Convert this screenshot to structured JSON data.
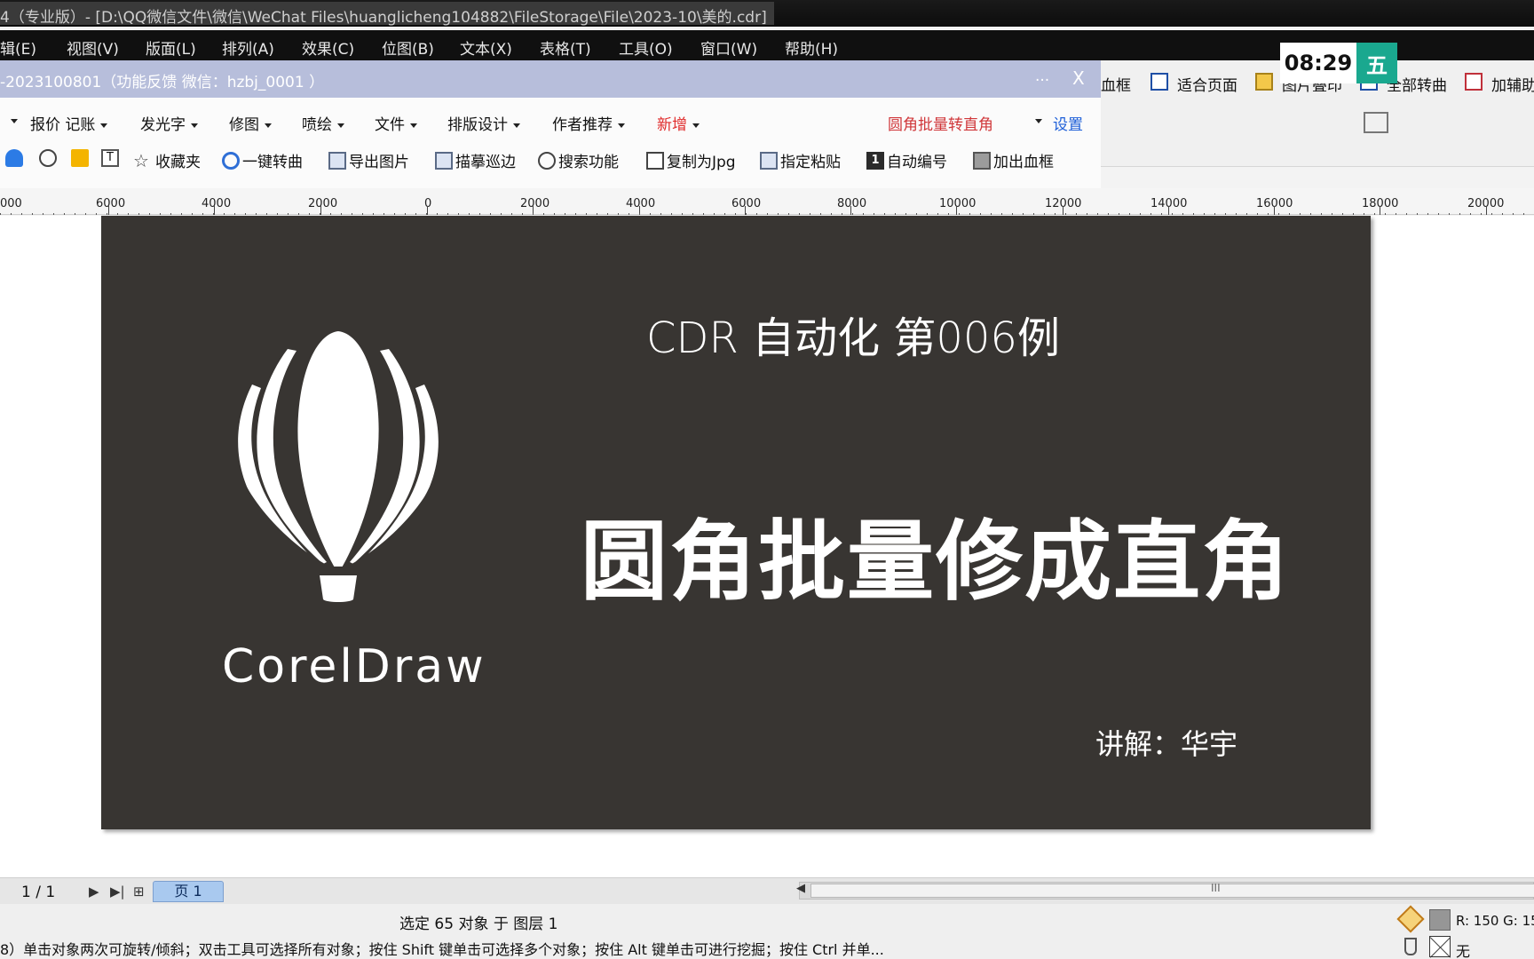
{
  "window": {
    "title": "4（专业版）- [D:\\QQ微信文件\\微信\\WeChat Files\\huanglicheng104882\\FileStorage\\File\\2023-10\\美的.cdr]"
  },
  "menu": [
    "辑(E)",
    "视图(V)",
    "版面(L)",
    "排列(A)",
    "效果(C)",
    "位图(B)",
    "文本(X)",
    "表格(T)",
    "工具(O)",
    "窗口(W)",
    "帮助(H)"
  ],
  "clock": {
    "time": "08:29",
    "weekday": "五"
  },
  "bg_toolbar": {
    "items": [
      "血框",
      "适合页面",
      "图片叠印",
      "全部转曲",
      "加辅助"
    ]
  },
  "plugin": {
    "title": "-2023100801（功能反馈 微信：hzbj_0001 ）",
    "dots": "...",
    "close": "X",
    "menus": [
      "报价 记账",
      "发光字",
      "修图",
      "喷绘",
      "文件",
      "排版设计",
      "作者推荐",
      "新增"
    ],
    "feature": "圆角批量转直角",
    "settings": "设置",
    "tools": [
      "收藏夹",
      "一键转曲",
      "导出图片",
      "描摹巡边",
      "搜索功能",
      "复制为Jpg",
      "指定粘贴",
      "自动编号",
      "加出血框"
    ],
    "tool_tbox": "T",
    "tool_num": "1"
  },
  "ruler": {
    "labels": [
      "000",
      "6000",
      "4000",
      "2000",
      "0",
      "2000",
      "4000",
      "6000",
      "8000",
      "10000",
      "12000",
      "14000",
      "16000",
      "18000",
      "20000"
    ]
  },
  "artboard": {
    "brand": "CorelDraw",
    "subtitle": "CDR 自动化 第006例",
    "headline": "圆角批量修成直角",
    "author": "讲解：华宇",
    "bg_color": "#383532"
  },
  "pagebar": {
    "counter": "1 / 1",
    "page_tab": "页 1",
    "scroll_grip": "III"
  },
  "status": {
    "selection": "选定 65 对象 于 图层 1",
    "hint": "8）单击对象两次可旋转/倾斜；双击工具可选择所有对象；按住 Shift 键单击可选择多个对象；按住 Alt 键单击可进行挖掘；按住 Ctrl 并单...",
    "fill_rgb": "R: 150 G: 15",
    "outline": "无"
  }
}
